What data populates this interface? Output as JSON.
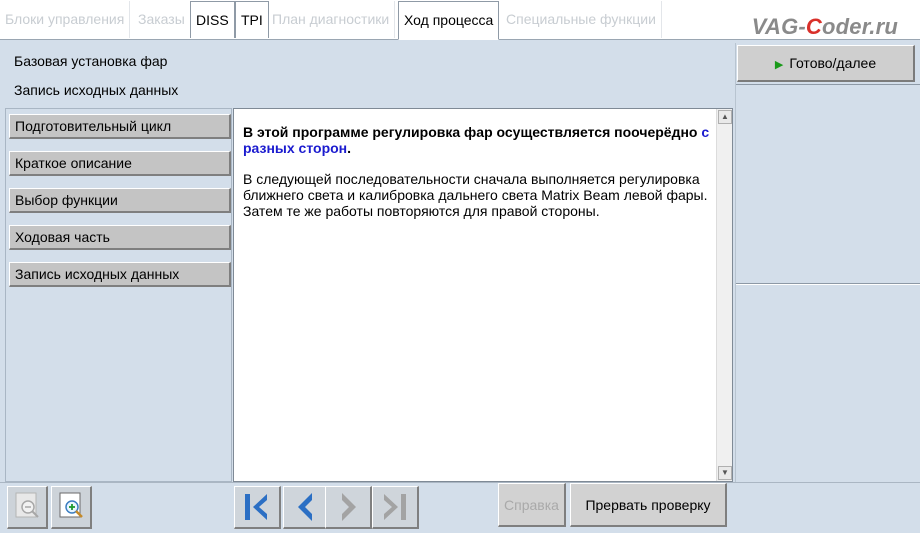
{
  "tabs": [
    {
      "label": "Блоки управления",
      "state": "disabled"
    },
    {
      "label": "Заказы",
      "state": "disabled"
    },
    {
      "label": "DISS",
      "state": "enabled"
    },
    {
      "label": "TPI",
      "state": "enabled"
    },
    {
      "label": "План диагностики",
      "state": "disabled"
    },
    {
      "label": "Ход процесса",
      "state": "active"
    },
    {
      "label": "Специальные функции",
      "state": "disabled"
    }
  ],
  "watermark": {
    "part1": "VAG-",
    "part2": "C",
    "part3": "oder.ru"
  },
  "header": {
    "line1": "Базовая установка фар",
    "line2": "Запись исходных данных"
  },
  "nav": {
    "items": [
      {
        "label": "Подготовительный цикл"
      },
      {
        "label": "Краткое описание"
      },
      {
        "label": "Выбор функции"
      },
      {
        "label": "Ходовая часть"
      },
      {
        "label": "Запись исходных данных"
      }
    ]
  },
  "content": {
    "bold_text": "В этой программе регулировка фар осуществляется поочерёдно ",
    "bold_highlight": "с разных сторон",
    "bold_end": ".",
    "paragraph1": "В следующей последовательности сначала выполняется регулировка ближнего света и калибровка дальнего света Matrix Beam левой фары.",
    "paragraph2": "Затем те же работы повторяются для правой стороны."
  },
  "right": {
    "next_label": "Готово/далее"
  },
  "bottom": {
    "help_label": "Справка",
    "abort_label": "Прервать проверку"
  },
  "colors": {
    "panel": "#d3deea",
    "accent_blue": "#1b1bcf",
    "nav_arrow": "#2b6fc4",
    "green_arrow": "#1a9a1a"
  }
}
